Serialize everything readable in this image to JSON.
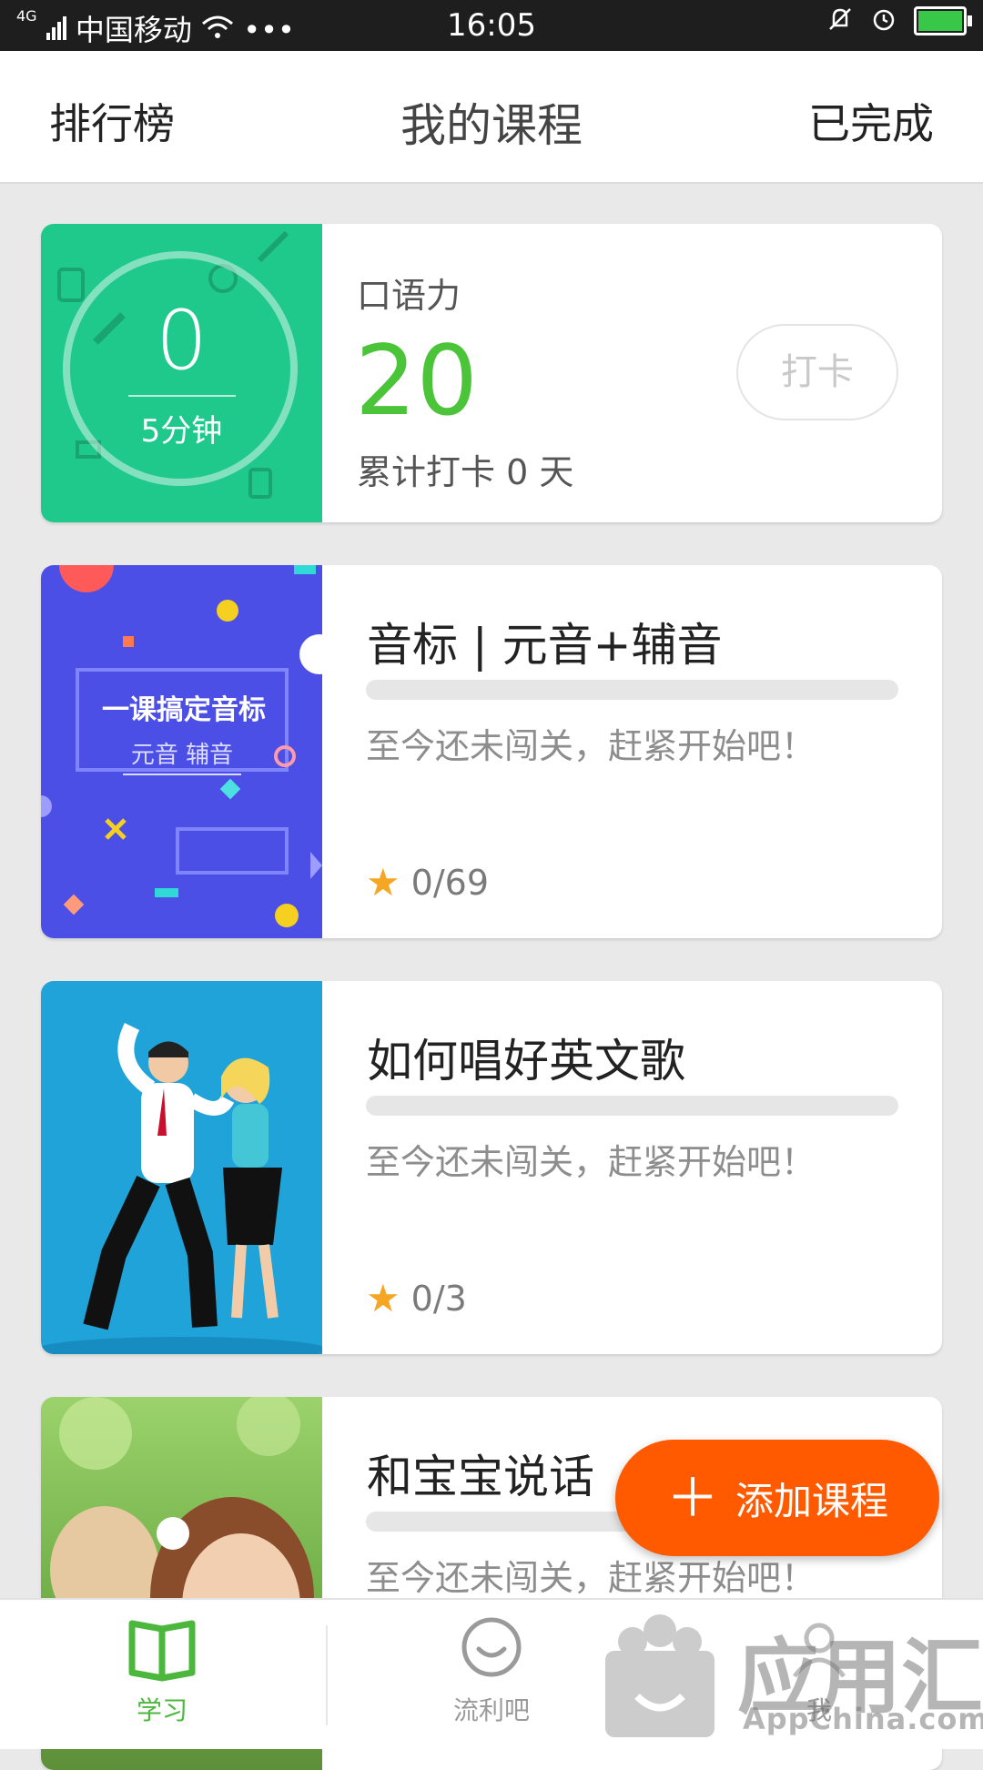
{
  "status_bar": {
    "network": "4G",
    "carrier": "中国移动",
    "more": "•••",
    "time": "16:05"
  },
  "header": {
    "left": "排行榜",
    "title": "我的课程",
    "right": "已完成"
  },
  "spoken_card": {
    "ring_value": "0",
    "ring_subtitle": "5分钟",
    "label": "口语力",
    "score": "20",
    "streak": "累计打卡 0 天",
    "checkin_button": "打卡",
    "accent_color": "#4bc43a",
    "thumb_color": "#1fc98b"
  },
  "courses": [
    {
      "title": "音标 | 元音+辅音",
      "status": "至今还未闯关，赶紧开始吧！",
      "stars": "0/69",
      "thumb_title": "一课搞定音标",
      "thumb_subtitle": "元音 辅音",
      "progress": 0
    },
    {
      "title": "如何唱好英文歌",
      "status": "至今还未闯关，赶紧开始吧！",
      "stars": "0/3",
      "progress": 0
    },
    {
      "title": "和宝宝说话",
      "status": "至今还未闯关，赶紧开始吧！",
      "progress": 0
    }
  ],
  "fab": {
    "label": "添加课程",
    "color": "#ff5a00"
  },
  "bottom_nav": [
    {
      "label": "学习",
      "icon": "book-icon",
      "active": true
    },
    {
      "label": "流利吧",
      "icon": "smile-bubble-icon",
      "active": false
    },
    {
      "label": "我",
      "icon": "person-icon",
      "active": false
    }
  ],
  "watermark": {
    "text": "应用汇",
    "sub": "AppChina.com"
  }
}
